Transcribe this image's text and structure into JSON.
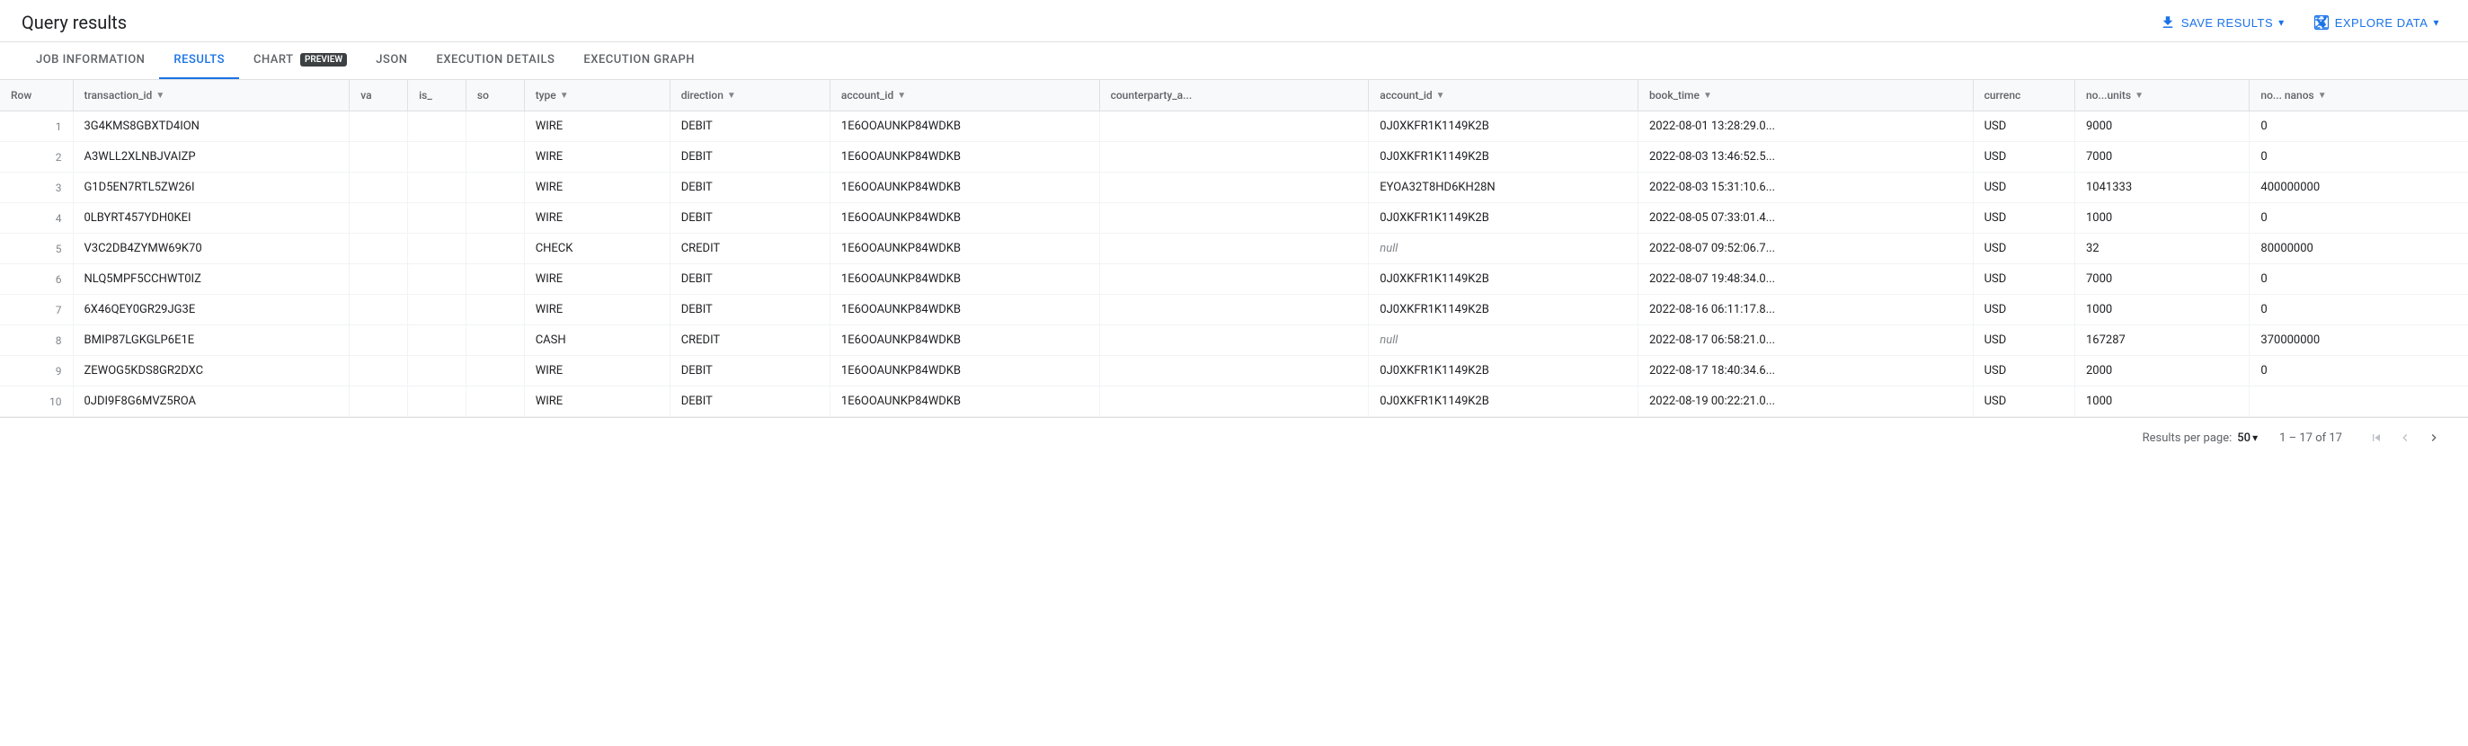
{
  "header": {
    "title": "Query results",
    "save_results_label": "SAVE RESULTS",
    "explore_data_label": "EXPLORE DATA"
  },
  "tabs": [
    {
      "id": "job-info",
      "label": "JOB INFORMATION",
      "active": false
    },
    {
      "id": "results",
      "label": "RESULTS",
      "active": true
    },
    {
      "id": "chart",
      "label": "CHART",
      "active": false,
      "badge": "PREVIEW"
    },
    {
      "id": "json",
      "label": "JSON",
      "active": false
    },
    {
      "id": "execution-details",
      "label": "EXECUTION DETAILS",
      "active": false
    },
    {
      "id": "execution-graph",
      "label": "EXECUTION GRAPH",
      "active": false
    }
  ],
  "table": {
    "columns": [
      {
        "id": "row",
        "label": "Row",
        "sortable": false
      },
      {
        "id": "transaction_id",
        "label": "transaction_id",
        "sortable": true
      },
      {
        "id": "va",
        "label": "va",
        "sortable": false
      },
      {
        "id": "is",
        "label": "is_",
        "sortable": false
      },
      {
        "id": "so",
        "label": "so",
        "sortable": false
      },
      {
        "id": "type",
        "label": "type",
        "sortable": true
      },
      {
        "id": "direction",
        "label": "direction",
        "sortable": true
      },
      {
        "id": "account_id",
        "label": "account_id",
        "sortable": true
      },
      {
        "id": "counterparty_a",
        "label": "counterparty_a...",
        "sortable": false
      },
      {
        "id": "cp_account_id",
        "label": "account_id",
        "sortable": true
      },
      {
        "id": "book_time",
        "label": "book_time",
        "sortable": true
      },
      {
        "id": "currency",
        "label": "currenc",
        "sortable": false
      },
      {
        "id": "no_units",
        "label": "no...units",
        "sortable": true
      },
      {
        "id": "no_nanos",
        "label": "no... nanos",
        "sortable": true
      }
    ],
    "rows": [
      {
        "row": 1,
        "transaction_id": "3G4KMS8GBXTD4ION",
        "va": "",
        "is": "",
        "so": "",
        "type": "WIRE",
        "direction": "DEBIT",
        "account_id": "1E6OOAUNKP84WDKB",
        "counterparty_a": "",
        "cp_account_id": "0J0XKFR1K1149K2B",
        "book_time": "2022-08-01 13:28:29.0...",
        "currency": "USD",
        "no_units": "9000",
        "no_nanos": "0"
      },
      {
        "row": 2,
        "transaction_id": "A3WLL2XLNBJVAIZP",
        "va": "",
        "is": "",
        "so": "",
        "type": "WIRE",
        "direction": "DEBIT",
        "account_id": "1E6OOAUNKP84WDKB",
        "counterparty_a": "",
        "cp_account_id": "0J0XKFR1K1149K2B",
        "book_time": "2022-08-03 13:46:52.5...",
        "currency": "USD",
        "no_units": "7000",
        "no_nanos": "0"
      },
      {
        "row": 3,
        "transaction_id": "G1D5EN7RTL5ZW26I",
        "va": "",
        "is": "",
        "so": "",
        "type": "WIRE",
        "direction": "DEBIT",
        "account_id": "1E6OOAUNKP84WDKB",
        "counterparty_a": "",
        "cp_account_id": "EYOA32T8HD6KH28N",
        "book_time": "2022-08-03 15:31:10.6...",
        "currency": "USD",
        "no_units": "1041333",
        "no_nanos": "400000000"
      },
      {
        "row": 4,
        "transaction_id": "0LBYRT457YDH0KEI",
        "va": "",
        "is": "",
        "so": "",
        "type": "WIRE",
        "direction": "DEBIT",
        "account_id": "1E6OOAUNKP84WDKB",
        "counterparty_a": "",
        "cp_account_id": "0J0XKFR1K1149K2B",
        "book_time": "2022-08-05 07:33:01.4...",
        "currency": "USD",
        "no_units": "1000",
        "no_nanos": "0"
      },
      {
        "row": 5,
        "transaction_id": "V3C2DB4ZYMW69K70",
        "va": "",
        "is": "",
        "so": "",
        "type": "CHECK",
        "direction": "CREDIT",
        "account_id": "1E6OOAUNKP84WDKB",
        "counterparty_a": "",
        "cp_account_id": "null",
        "cp_account_id_null": true,
        "book_time": "2022-08-07 09:52:06.7...",
        "currency": "USD",
        "no_units": "32",
        "no_nanos": "80000000"
      },
      {
        "row": 6,
        "transaction_id": "NLQ5MPF5CCHWT0IZ",
        "va": "",
        "is": "",
        "so": "",
        "type": "WIRE",
        "direction": "DEBIT",
        "account_id": "1E6OOAUNKP84WDKB",
        "counterparty_a": "",
        "cp_account_id": "0J0XKFR1K1149K2B",
        "book_time": "2022-08-07 19:48:34.0...",
        "currency": "USD",
        "no_units": "7000",
        "no_nanos": "0"
      },
      {
        "row": 7,
        "transaction_id": "6X46QEY0GR29JG3E",
        "va": "",
        "is": "",
        "so": "",
        "type": "WIRE",
        "direction": "DEBIT",
        "account_id": "1E6OOAUNKP84WDKB",
        "counterparty_a": "",
        "cp_account_id": "0J0XKFR1K1149K2B",
        "book_time": "2022-08-16 06:11:17.8...",
        "currency": "USD",
        "no_units": "1000",
        "no_nanos": "0"
      },
      {
        "row": 8,
        "transaction_id": "BMIP87LGKGLP6E1E",
        "va": "",
        "is": "",
        "so": "",
        "type": "CASH",
        "direction": "CREDIT",
        "account_id": "1E6OOAUNKP84WDKB",
        "counterparty_a": "",
        "cp_account_id": "null",
        "cp_account_id_null": true,
        "book_time": "2022-08-17 06:58:21.0...",
        "currency": "USD",
        "no_units": "167287",
        "no_nanos": "370000000"
      },
      {
        "row": 9,
        "transaction_id": "ZEWOG5KDS8GR2DXC",
        "va": "",
        "is": "",
        "so": "",
        "type": "WIRE",
        "direction": "DEBIT",
        "account_id": "1E6OOAUNKP84WDKB",
        "counterparty_a": "",
        "cp_account_id": "0J0XKFR1K1149K2B",
        "book_time": "2022-08-17 18:40:34.6...",
        "currency": "USD",
        "no_units": "2000",
        "no_nanos": "0"
      },
      {
        "row": 10,
        "transaction_id": "0JDI9F8G6MVZ5ROA",
        "va": "",
        "is": "",
        "so": "",
        "type": "WIRE",
        "direction": "DEBIT",
        "account_id": "1E6OOAUNKP84WDKB",
        "counterparty_a": "",
        "cp_account_id": "0J0XKFR1K1149K2B",
        "book_time": "2022-08-19 00:22:21.0...",
        "currency": "USD",
        "no_units": "1000",
        "no_nanos": ""
      }
    ]
  },
  "footer": {
    "rows_per_page_label": "Results per page:",
    "rows_per_page_value": "50",
    "pagination_info": "1 – 17 of 17"
  }
}
